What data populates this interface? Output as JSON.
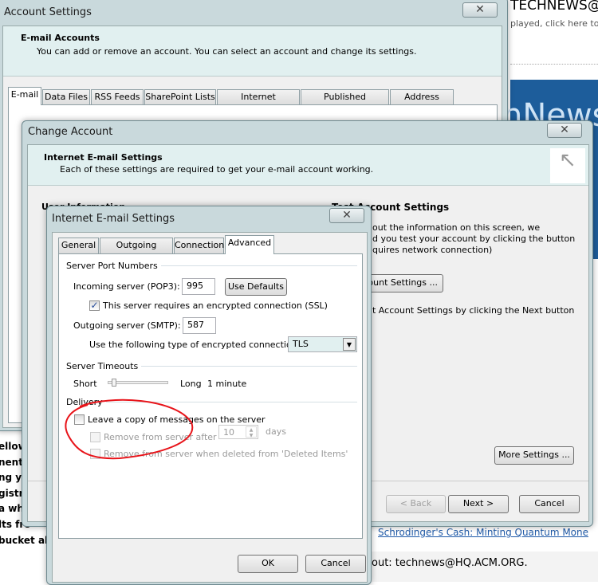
{
  "background": {
    "header_text": "TECHNEWS@L",
    "view_text": "played, click here to vi",
    "banner_text": "nNews",
    "link_text": "Schrodinger's Cash: Minting Quantum Mone",
    "footer_text": "out: technews@HQ.ACM.ORG.",
    "left_fragments": [
      "ellow",
      "nent r",
      "ng yo",
      "gistry",
      "a wh",
      "lts fro",
      "bucket albu"
    ],
    "colors": {
      "banner": "#1d5d9b",
      "link": "#1f5aa8"
    }
  },
  "account_settings": {
    "title": "Account Settings",
    "header_title": "E-mail Accounts",
    "header_desc": "You can add or remove an account. You can select an account and change its settings.",
    "tabs": [
      "E-mail",
      "Data Files",
      "RSS Feeds",
      "SharePoint Lists",
      "Internet Calendars",
      "Published Calendars",
      "Address Books"
    ],
    "active_tab": "E-mail"
  },
  "change_account": {
    "title": "Change Account",
    "header_title": "Internet E-mail Settings",
    "header_desc": "Each of these settings are required to get your e-mail account working.",
    "user_info_heading": "User Information",
    "test_heading": "Test Account Settings",
    "test_lines": [
      "out the information on this screen, we",
      "d you test your account by clicking the button",
      "quires network connection)"
    ],
    "test_button": "ount Settings ...",
    "next_note": "t Account Settings by clicking the Next button",
    "more_settings": "More Settings ...",
    "back": "< Back",
    "next": "Next >",
    "cancel": "Cancel"
  },
  "internet_settings": {
    "title": "Internet E-mail Settings",
    "tabs": [
      "General",
      "Outgoing Server",
      "Connection",
      "Advanced"
    ],
    "active_tab": "Advanced",
    "server_ports": {
      "heading": "Server Port Numbers",
      "incoming_label": "Incoming server (POP3):",
      "incoming_value": "995",
      "use_defaults": "Use Defaults",
      "ssl_label": "This server requires an encrypted connection (SSL)",
      "ssl_checked": true,
      "outgoing_label": "Outgoing server (SMTP):",
      "outgoing_value": "587",
      "encryption_label": "Use the following type of encrypted connection:",
      "encryption_value": "TLS"
    },
    "timeouts": {
      "heading": "Server Timeouts",
      "short": "Short",
      "long": "Long",
      "value": "1 minute",
      "slider_level": 0.05
    },
    "delivery": {
      "heading": "Delivery",
      "leave_copy": "Leave a copy of messages on the server",
      "leave_copy_checked": false,
      "remove_after": "Remove from server after",
      "remove_after_days": "10",
      "days": "days",
      "remove_deleted": "Remove from server when deleted from 'Deleted Items'"
    },
    "ok": "OK",
    "cancel": "Cancel",
    "annotation_color": "#e8141a"
  }
}
